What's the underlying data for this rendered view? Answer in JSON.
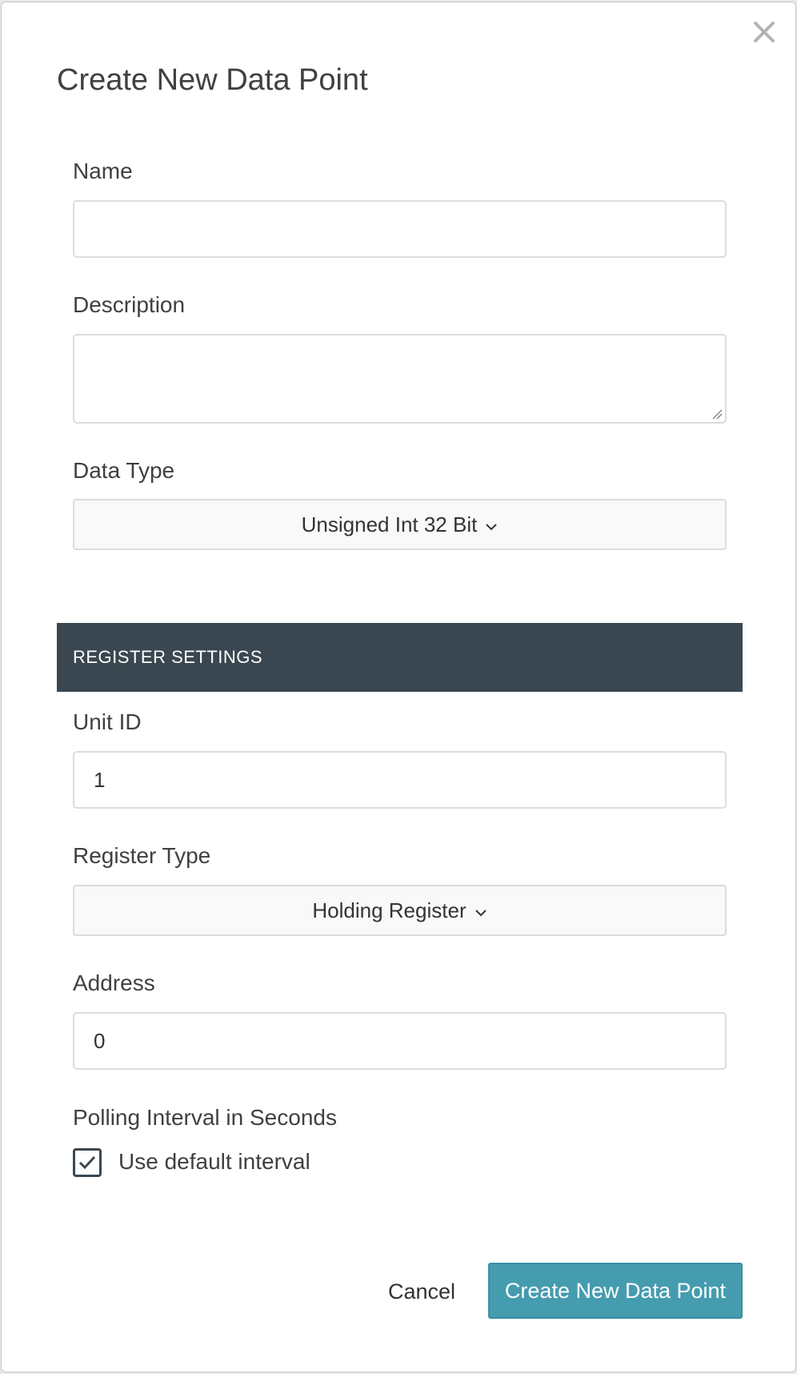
{
  "dialog": {
    "title": "Create New Data Point"
  },
  "fields": {
    "name": {
      "label": "Name",
      "value": ""
    },
    "description": {
      "label": "Description",
      "value": ""
    },
    "data_type": {
      "label": "Data Type",
      "selected": "Unsigned Int 32 Bit"
    }
  },
  "register_settings": {
    "header": "REGISTER SETTINGS",
    "unit_id": {
      "label": "Unit ID",
      "value": "1"
    },
    "register_type": {
      "label": "Register Type",
      "selected": "Holding Register"
    },
    "address": {
      "label": "Address",
      "value": "0"
    },
    "polling": {
      "label": "Polling Interval in Seconds",
      "checkbox_label": "Use default interval",
      "checked": true
    }
  },
  "footer": {
    "cancel_label": "Cancel",
    "submit_label": "Create New Data Point"
  },
  "colors": {
    "section_header_bg": "#3a4750",
    "primary_button_bg": "#459caf"
  },
  "icons": {
    "close": "close-icon",
    "dropdown": "chevron-down-icon",
    "check": "checkmark-icon",
    "resize": "resize-grip-icon"
  }
}
